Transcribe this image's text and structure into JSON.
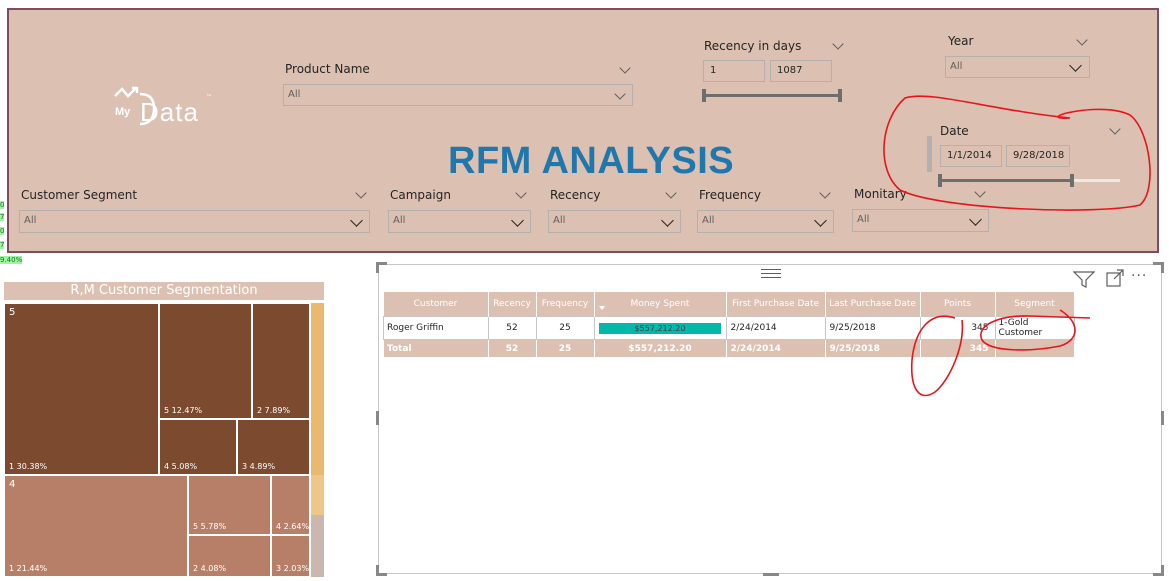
{
  "header": {
    "title": "RFM ANALYSIS",
    "logo": {
      "my": "My",
      "rest": "Data",
      "tm": "™"
    },
    "slicers": {
      "product_name": {
        "label": "Product Name",
        "value": "All"
      },
      "recency_days": {
        "label": "Recency in days",
        "min": "1",
        "max": "1087"
      },
      "year": {
        "label": "Year",
        "value": "All"
      },
      "date": {
        "label": "Date",
        "start": "1/1/2014",
        "end": "9/28/2018"
      },
      "customer_segment": {
        "label": "Customer Segment",
        "value": "All"
      },
      "campaign": {
        "label": "Campaign",
        "value": "All"
      },
      "recency": {
        "label": "Recency",
        "value": "All"
      },
      "frequency": {
        "label": "Frequency",
        "value": "All"
      },
      "monitary": {
        "label": "Monitary",
        "value": "All"
      }
    }
  },
  "side_labels": [
    "0",
    "7",
    "0",
    "7",
    "9.40%"
  ],
  "treemap": {
    "title": "R,M Customer Segmentation",
    "groups": [
      {
        "label": "5",
        "tiles": [
          {
            "label": "1 30.38%"
          },
          {
            "label": "5 12.47%"
          },
          {
            "label": "2 7.89%"
          },
          {
            "label": "4 5.08%"
          },
          {
            "label": "3 4.89%"
          }
        ]
      },
      {
        "label": "4",
        "tiles": [
          {
            "label": "1 21.44%"
          },
          {
            "label": "5 5.78%"
          },
          {
            "label": "4 2.64%"
          },
          {
            "label": "2 4.08%"
          },
          {
            "label": "3 2.03%"
          }
        ]
      }
    ],
    "colors": {
      "group5": "#7b4a2f",
      "group4": "#b77f67",
      "side": "#e8b96e"
    }
  },
  "table": {
    "columns": [
      "Customer",
      "Recency",
      "Frequency",
      "Money Spent",
      "First Purchase Date",
      "Last Purchase Date",
      "Points",
      "Segment"
    ],
    "rows": [
      {
        "customer": "Roger Griffin",
        "recency": "52",
        "frequency": "25",
        "money": "$557,212.20",
        "money_fraction": 1.0,
        "first": "2/24/2014",
        "last": "9/25/2018",
        "points": "345",
        "segment": "1-Gold Customer"
      }
    ],
    "total": {
      "label": "Total",
      "recency": "52",
      "frequency": "25",
      "money": "$557,212.20",
      "first": "2/24/2014",
      "last": "9/25/2018",
      "points": "345",
      "segment": ""
    }
  },
  "colors": {
    "header_bg": "#dcc0b2",
    "border": "#7f4b5e",
    "title": "#1f77ab",
    "bar": "#01b8aa",
    "annotation": "#e8141b"
  }
}
